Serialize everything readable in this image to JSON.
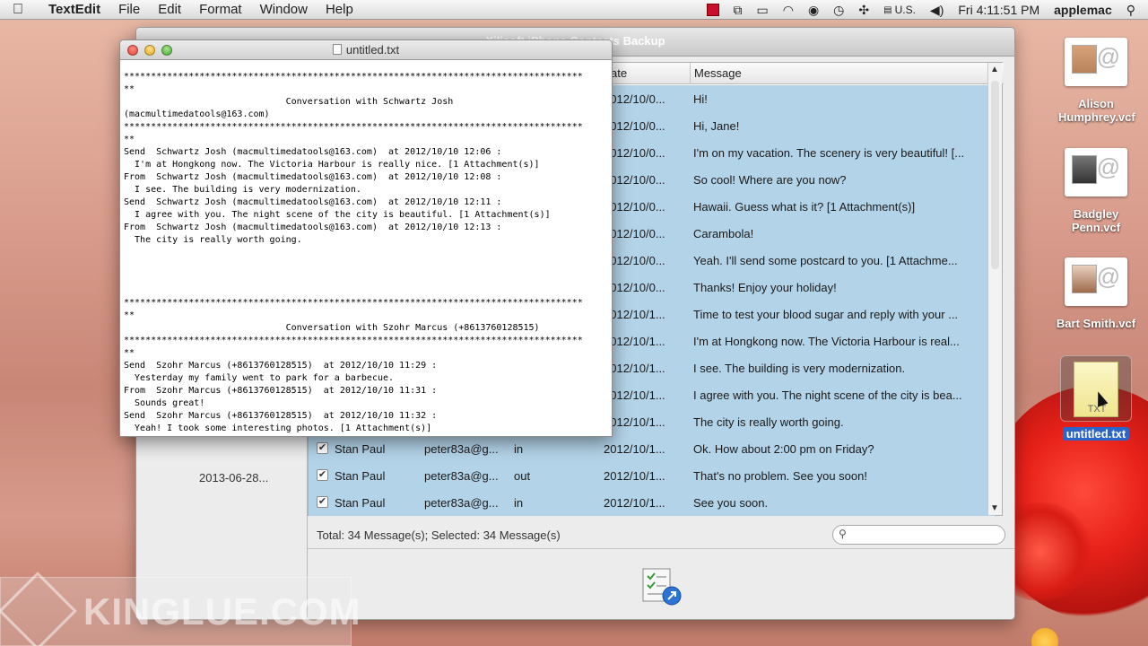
{
  "menubar": {
    "app_name": "TextEdit",
    "menus": [
      "File",
      "Edit",
      "Format",
      "Window",
      "Help"
    ],
    "input_source": "U.S.",
    "clock": "Fri 4:11:51 PM",
    "user": "applemac"
  },
  "app_window": {
    "title": "Xilisoft iPhone Contacts Backup",
    "left_date": "2013-06-28...",
    "columns": {
      "date": "ate",
      "message": "Message"
    },
    "rows": [
      {
        "name": "",
        "email": "",
        "dir": "",
        "date": "2012/10/0...",
        "message": "Hi!"
      },
      {
        "name": "",
        "email": "",
        "dir": "",
        "date": "2012/10/0...",
        "message": "Hi, Jane!"
      },
      {
        "name": "",
        "email": "",
        "dir": "",
        "date": "2012/10/0...",
        "message": "I'm on my vacation. The scenery is very beautiful! [..."
      },
      {
        "name": "",
        "email": "",
        "dir": "",
        "date": "2012/10/0...",
        "message": "So cool! Where are you now?"
      },
      {
        "name": "",
        "email": "",
        "dir": "",
        "date": "2012/10/0...",
        "message": "Hawaii. Guess what is it? [1 Attachment(s)]"
      },
      {
        "name": "",
        "email": "",
        "dir": "",
        "date": "2012/10/0...",
        "message": "Carambola!"
      },
      {
        "name": "",
        "email": "",
        "dir": "",
        "date": "2012/10/0...",
        "message": "Yeah. I'll send some postcard to you. [1 Attachme..."
      },
      {
        "name": "",
        "email": "",
        "dir": "",
        "date": "2012/10/0...",
        "message": "Thanks! Enjoy your holiday!"
      },
      {
        "name": "",
        "email": "",
        "dir": "",
        "date": "2012/10/1...",
        "message": "Time to test your blood sugar and reply with your ..."
      },
      {
        "name": "",
        "email": "",
        "dir": "",
        "date": "2012/10/1...",
        "message": "I'm at Hongkong now. The Victoria Harbour is real..."
      },
      {
        "name": "",
        "email": "",
        "dir": "",
        "date": "2012/10/1...",
        "message": "I see. The building is very modernization."
      },
      {
        "name": "",
        "email": "",
        "dir": "",
        "date": "2012/10/1...",
        "message": "I agree with you. The night scene of the city is bea..."
      },
      {
        "name": "",
        "email": "",
        "dir": "",
        "date": "2012/10/1...",
        "message": "The city is really worth going."
      },
      {
        "name": "Stan Paul",
        "email": "peter83a@g...",
        "dir": "in",
        "date": "2012/10/1...",
        "message": "Ok. How about 2:00 pm on Friday?"
      },
      {
        "name": "Stan Paul",
        "email": "peter83a@g...",
        "dir": "out",
        "date": "2012/10/1...",
        "message": "That's no problem. See you soon!"
      },
      {
        "name": "Stan Paul",
        "email": "peter83a@g...",
        "dir": "in",
        "date": "2012/10/1...",
        "message": "See you soon."
      }
    ],
    "status": "Total: 34 Message(s); Selected: 34 Message(s)",
    "checkmark": "✔"
  },
  "textedit": {
    "title": "untitled.txt",
    "lines": [
      "*************************************************************************************",
      "**",
      "                              Conversation with Schwartz Josh",
      "(macmultimedatools@163.com)",
      "*************************************************************************************",
      "**",
      "Send  Schwartz Josh (macmultimedatools@163.com)  at 2012/10/10 12:06 :",
      "  I'm at Hongkong now. The Victoria Harbour is really nice. [1 Attachment(s)]",
      "From  Schwartz Josh (macmultimedatools@163.com)  at 2012/10/10 12:08 :",
      "  I see. The building is very modernization.",
      "Send  Schwartz Josh (macmultimedatools@163.com)  at 2012/10/10 12:11 :",
      "  I agree with you. The night scene of the city is beautiful. [1 Attachment(s)]",
      "From  Schwartz Josh (macmultimedatools@163.com)  at 2012/10/10 12:13 :",
      "  The city is really worth going.",
      "",
      "",
      "",
      "",
      "*************************************************************************************",
      "**",
      "                              Conversation with Szohr Marcus (+8613760128515)",
      "*************************************************************************************",
      "**",
      "Send  Szohr Marcus (+8613760128515)  at 2012/10/10 11:29 :",
      "  Yesterday my family went to park for a barbecue.",
      "From  Szohr Marcus (+8613760128515)  at 2012/10/10 11:31 :",
      "  Sounds great!",
      "Send  Szohr Marcus (+8613760128515)  at 2012/10/10 11:32 :",
      "  Yeah! I took some interesting photos. [1 Attachment(s)]"
    ]
  },
  "desktop": {
    "icons": [
      {
        "label": "Alison Humphrey.vcf"
      },
      {
        "label": "Badgley Penn.vcf"
      },
      {
        "label": "Bart Smith.vcf"
      },
      {
        "label": "untitled.txt",
        "ext": "TXT"
      }
    ],
    "at_sign": "@"
  },
  "watermark": "KINGLUE.COM"
}
